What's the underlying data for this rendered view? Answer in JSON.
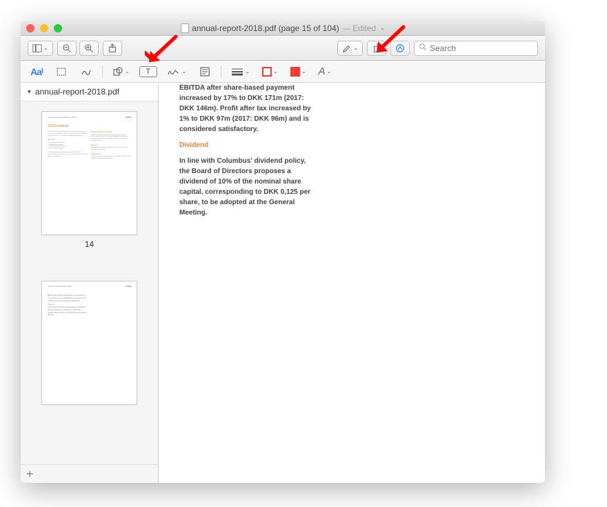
{
  "window": {
    "filename": "annual-report-2018.pdf",
    "page_current": 15,
    "page_total": 104,
    "title": "annual-report-2018.pdf (page 15 of 104)",
    "status": "Edited"
  },
  "toolbar": {
    "search_placeholder": "Search"
  },
  "markup": {
    "text_style_label": "Aa",
    "text_insert_label": "T",
    "font_style_label": "A"
  },
  "sidebar": {
    "filename": "annual-report-2018.pdf",
    "thumbnails": [
      {
        "number": 14,
        "title": "2018 outlined"
      }
    ]
  },
  "page": {
    "para1": "EBITDA after share-based payment increased by 17% to DKK 171m (2017: DKK 146m). Profit after tax increased by 1% to DKK 97m (2017: DKK 96m) and is considered satisfactory.",
    "heading": "Dividend",
    "para2": "In line with Columbus' dividend policy, the Board of Directors proposes a dividend of 10% of the nominal share capital, corresponding to DKK 0,125 per share, to be adopted at the General Meeting."
  },
  "icons": {
    "sidebar_view": "sidebar-icon",
    "zoom_out": "zoom-out-icon",
    "zoom_in": "zoom-in-icon",
    "share": "share-icon",
    "highlight": "highlight-icon",
    "rotate": "rotate-icon",
    "markup_toggle": "markup-pen-icon",
    "select": "selection-icon",
    "sketch": "sketch-icon",
    "shapes": "shapes-icon",
    "text": "text-icon",
    "sign": "sign-icon",
    "note": "note-icon",
    "line_style": "line-style-icon",
    "border_color": "border-color-icon",
    "fill_color": "fill-color-icon",
    "text_style": "text-style-icon"
  }
}
